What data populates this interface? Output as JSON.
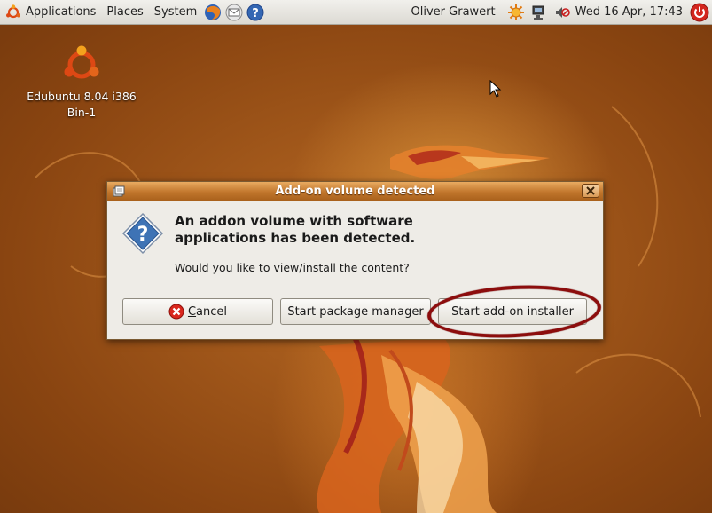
{
  "panel": {
    "menus": [
      "Applications",
      "Places",
      "System"
    ],
    "user": "Oliver Grawert",
    "clock": "Wed 16 Apr, 17:43"
  },
  "desktop": {
    "icon_label_line1": "Edubuntu 8.04 i386",
    "icon_label_line2": "Bin-1"
  },
  "dialog": {
    "title": "Add-on volume detected",
    "headline_line1": "An addon volume with software",
    "headline_line2": "applications has been detected.",
    "question": "Would you like to view/install the content?",
    "cancel_label_first": "C",
    "cancel_label_rest": "ancel",
    "package_manager_label": "Start package manager",
    "addon_installer_label": "Start add-on installer"
  },
  "colors": {
    "titlebar": "#c1762c",
    "highlight": "#8c0d0d"
  }
}
